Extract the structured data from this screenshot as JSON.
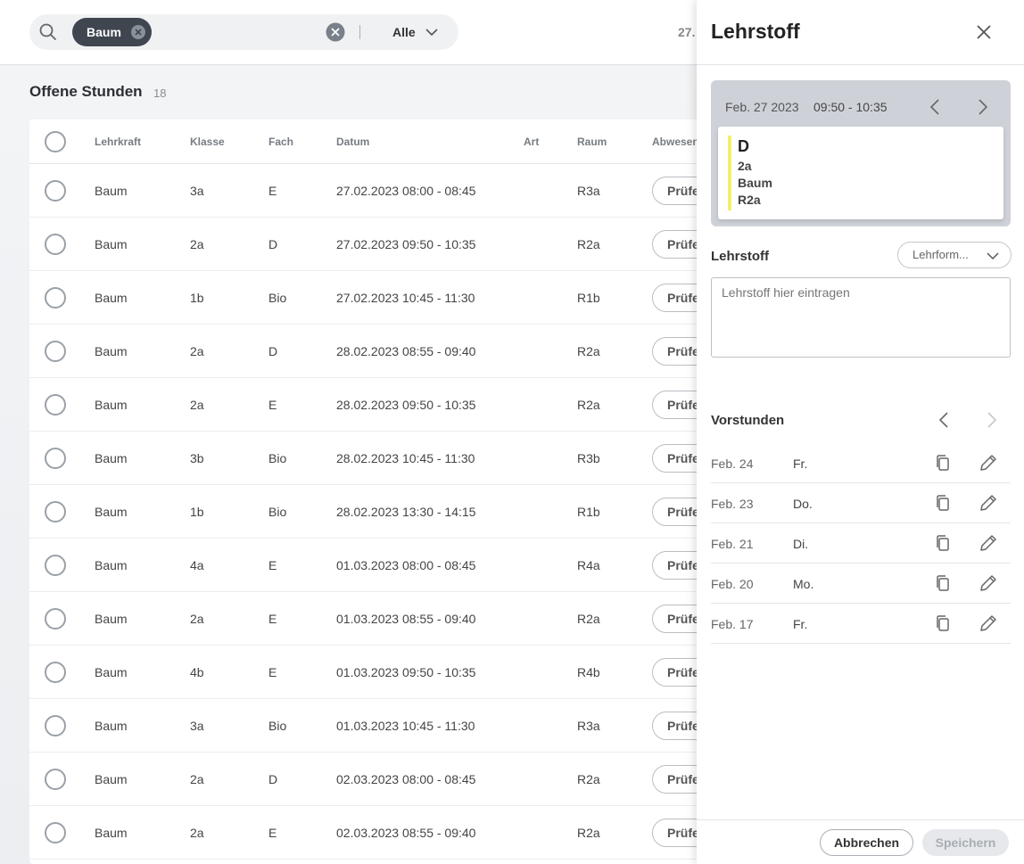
{
  "topbar": {
    "search_icon": "search-icon",
    "chip_label": "Baum",
    "filter_value": "Alle",
    "date_partial": "27."
  },
  "list": {
    "title": "Offene Stunden",
    "count": "18",
    "columns": [
      "Lehrkraft",
      "Klasse",
      "Fach",
      "Datum",
      "Art",
      "Raum",
      "Abwesen"
    ],
    "action_label": "Prüfe",
    "rows": [
      {
        "teacher": "Baum",
        "class": "3a",
        "subject": "E",
        "date": "27.02.2023 08:00 - 08:45",
        "room": "R3a"
      },
      {
        "teacher": "Baum",
        "class": "2a",
        "subject": "D",
        "date": "27.02.2023 09:50 - 10:35",
        "room": "R2a"
      },
      {
        "teacher": "Baum",
        "class": "1b",
        "subject": "Bio",
        "date": "27.02.2023 10:45 - 11:30",
        "room": "R1b"
      },
      {
        "teacher": "Baum",
        "class": "2a",
        "subject": "D",
        "date": "28.02.2023 08:55 - 09:40",
        "room": "R2a"
      },
      {
        "teacher": "Baum",
        "class": "2a",
        "subject": "E",
        "date": "28.02.2023 09:50 - 10:35",
        "room": "R2a"
      },
      {
        "teacher": "Baum",
        "class": "3b",
        "subject": "Bio",
        "date": "28.02.2023 10:45 - 11:30",
        "room": "R3b"
      },
      {
        "teacher": "Baum",
        "class": "1b",
        "subject": "Bio",
        "date": "28.02.2023 13:30 - 14:15",
        "room": "R1b"
      },
      {
        "teacher": "Baum",
        "class": "4a",
        "subject": "E",
        "date": "01.03.2023 08:00 - 08:45",
        "room": "R4a"
      },
      {
        "teacher": "Baum",
        "class": "2a",
        "subject": "E",
        "date": "01.03.2023 08:55 - 09:40",
        "room": "R2a"
      },
      {
        "teacher": "Baum",
        "class": "4b",
        "subject": "E",
        "date": "01.03.2023 09:50 - 10:35",
        "room": "R4b"
      },
      {
        "teacher": "Baum",
        "class": "3a",
        "subject": "Bio",
        "date": "01.03.2023 10:45 - 11:30",
        "room": "R3a"
      },
      {
        "teacher": "Baum",
        "class": "2a",
        "subject": "D",
        "date": "02.03.2023 08:00 - 08:45",
        "room": "R2a"
      },
      {
        "teacher": "Baum",
        "class": "2a",
        "subject": "E",
        "date": "02.03.2023 08:55 - 09:40",
        "room": "R2a"
      }
    ]
  },
  "panel": {
    "title": "Lehrstoff",
    "lesson": {
      "date": "Feb. 27 2023",
      "time": "09:50 - 10:35",
      "subject": "D",
      "class": "2a",
      "teacher": "Baum",
      "room": "R2a",
      "accent_color": "#f2f06a"
    },
    "lehrstoff_label": "Lehrstoff",
    "lehrform_label": "Lehrform...",
    "textarea_placeholder": "Lehrstoff hier eintragen",
    "vorstunden_title": "Vorstunden",
    "vorstunden": [
      {
        "date": "Feb. 24",
        "day": "Fr."
      },
      {
        "date": "Feb. 23",
        "day": "Do."
      },
      {
        "date": "Feb. 21",
        "day": "Di."
      },
      {
        "date": "Feb. 20",
        "day": "Mo."
      },
      {
        "date": "Feb. 17",
        "day": "Fr."
      }
    ],
    "cancel_label": "Abbrechen",
    "save_label": "Speichern"
  }
}
